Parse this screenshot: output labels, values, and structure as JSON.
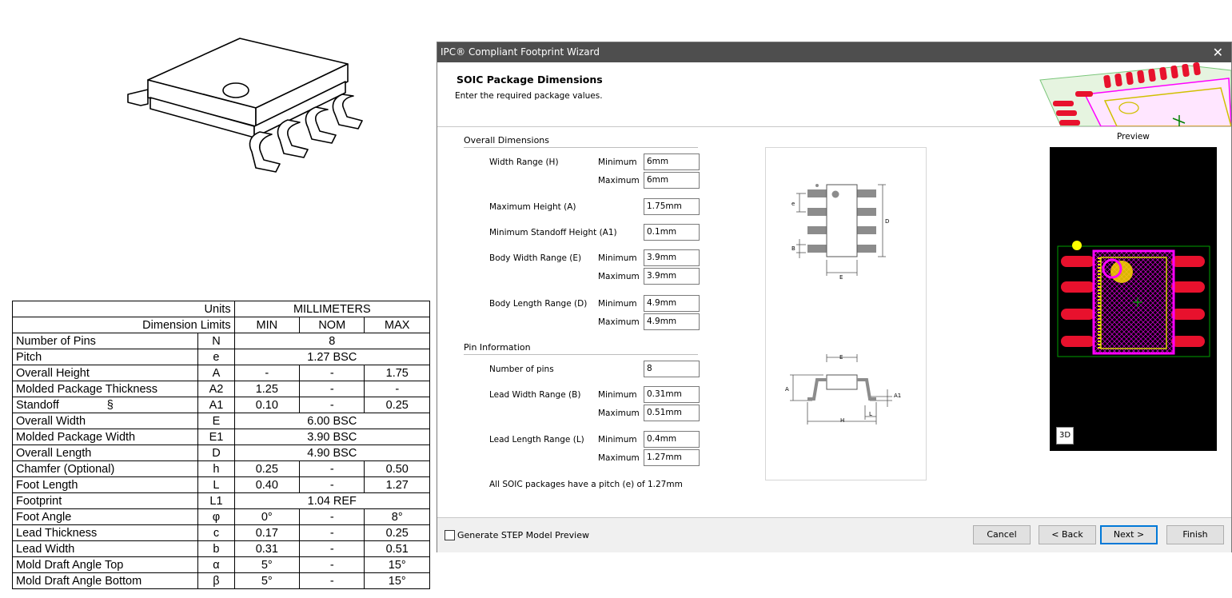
{
  "datasheet": {
    "table": {
      "header1": {
        "label": "Units",
        "value": "MILLIMETERS"
      },
      "header2": {
        "label": "Dimension Limits",
        "min": "MIN",
        "nom": "NOM",
        "max": "MAX"
      },
      "rows": [
        {
          "name": "Number of Pins",
          "sym": "N",
          "span": "8"
        },
        {
          "name": "Pitch",
          "sym": "e",
          "span": "1.27 BSC"
        },
        {
          "name": "Overall Height",
          "sym": "A",
          "min": "-",
          "nom": "-",
          "max": "1.75"
        },
        {
          "name": "Molded Package Thickness",
          "sym": "A2",
          "min": "1.25",
          "nom": "-",
          "max": "-"
        },
        {
          "name": "Standoff",
          "mark": "§",
          "sym": "A1",
          "min": "0.10",
          "nom": "-",
          "max": "0.25"
        },
        {
          "name": "Overall Width",
          "sym": "E",
          "span": "6.00 BSC"
        },
        {
          "name": "Molded Package Width",
          "sym": "E1",
          "span": "3.90 BSC"
        },
        {
          "name": "Overall Length",
          "sym": "D",
          "span": "4.90 BSC"
        },
        {
          "name": "Chamfer (Optional)",
          "sym": "h",
          "min": "0.25",
          "nom": "-",
          "max": "0.50"
        },
        {
          "name": "Foot Length",
          "sym": "L",
          "min": "0.40",
          "nom": "-",
          "max": "1.27"
        },
        {
          "name": "Footprint",
          "sym": "L1",
          "span": "1.04 REF"
        },
        {
          "name": "Foot Angle",
          "sym": "φ",
          "min": "0°",
          "nom": "-",
          "max": "8°"
        },
        {
          "name": "Lead Thickness",
          "sym": "c",
          "min": "0.17",
          "nom": "-",
          "max": "0.25"
        },
        {
          "name": "Lead Width",
          "sym": "b",
          "min": "0.31",
          "nom": "-",
          "max": "0.51"
        },
        {
          "name": "Mold Draft Angle Top",
          "sym": "α",
          "min": "5°",
          "nom": "-",
          "max": "15°"
        },
        {
          "name": "Mold Draft Angle Bottom",
          "sym": "β",
          "min": "5°",
          "nom": "-",
          "max": "15°"
        }
      ]
    }
  },
  "wizard": {
    "title": "IPC® Compliant Footprint Wizard",
    "close": "✕",
    "heading": "SOIC Package Dimensions",
    "subheading": "Enter the required package values.",
    "overall_section": "Overall Dimensions",
    "pin_section": "Pin Information",
    "width_range": {
      "label": "Width Range (H)",
      "min_label": "Minimum",
      "max_label": "Maximum",
      "min": "6mm",
      "max": "6mm"
    },
    "max_height": {
      "label": "Maximum Height (A)",
      "value": "1.75mm"
    },
    "min_standoff": {
      "label": "Minimum Standoff Height (A1)",
      "value": "0.1mm"
    },
    "body_width": {
      "label": "Body Width Range (E)",
      "min_label": "Minimum",
      "max_label": "Maximum",
      "min": "3.9mm",
      "max": "3.9mm"
    },
    "body_length": {
      "label": "Body Length Range (D)",
      "min_label": "Minimum",
      "max_label": "Maximum",
      "min": "4.9mm",
      "max": "4.9mm"
    },
    "num_pins": {
      "label": "Number of pins",
      "value": "8"
    },
    "lead_width": {
      "label": "Lead Width Range (B)",
      "min_label": "Minimum",
      "max_label": "Maximum",
      "min": "0.31mm",
      "max": "0.51mm"
    },
    "lead_length": {
      "label": "Lead Length Range (L)",
      "min_label": "Minimum",
      "max_label": "Maximum",
      "min": "0.4mm",
      "max": "1.27mm"
    },
    "pitch_note": "All SOIC packages have a pitch (e) of 1.27mm",
    "diagram_labels": {
      "e": "e",
      "b": "B",
      "d": "D",
      "e_body": "E",
      "e_top": "E",
      "a": "A",
      "a1": "A1",
      "h": "H",
      "l": "L"
    },
    "preview_label": "Preview",
    "btn_3d": "3D",
    "step_checkbox": "Generate STEP Model Preview",
    "buttons": {
      "cancel": "Cancel",
      "back": "< Back",
      "next": "Next >",
      "finish": "Finish"
    }
  }
}
